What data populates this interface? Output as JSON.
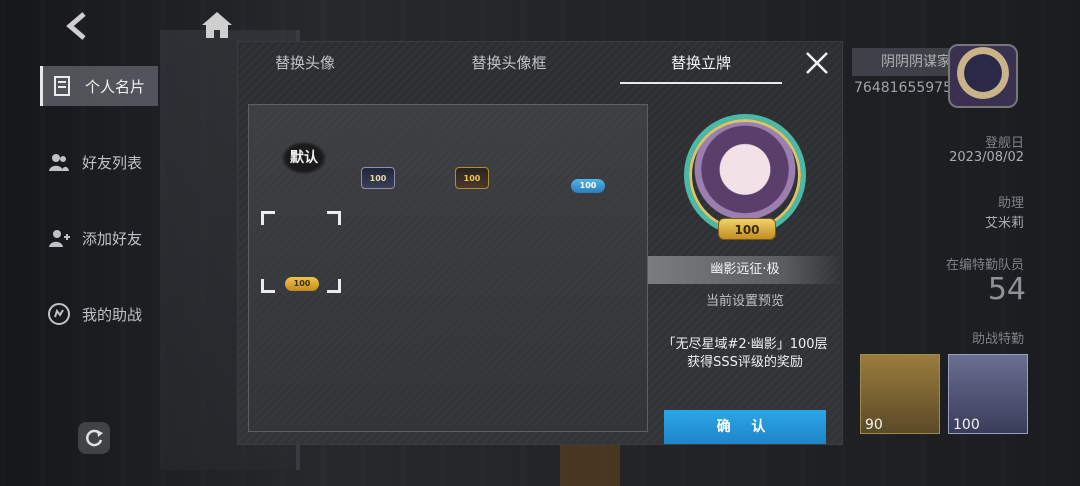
{
  "nav": {
    "back_icon": "back-arrow-icon",
    "home_icon": "home-icon"
  },
  "side_menu": {
    "items": [
      {
        "label": "个人名片",
        "icon": "id-card-icon",
        "active": true
      },
      {
        "label": "好友列表",
        "icon": "friends-icon",
        "active": false
      },
      {
        "label": "添加好友",
        "icon": "add-friend-icon",
        "active": false
      },
      {
        "label": "我的助战",
        "icon": "assist-icon",
        "active": false
      }
    ],
    "refresh_icon": "refresh-icon"
  },
  "profile": {
    "name": "阴阴阴谋家",
    "uid": "76481655975",
    "login_label": "登舰日",
    "login_date": "2023/08/02",
    "assistant_label": "助理",
    "assistant_name": "艾米莉",
    "team_label": "在编特勤队员",
    "team_count": "54",
    "assist_label": "助战特勤",
    "assist_cards": [
      {
        "level": "90"
      },
      {
        "level": "100"
      }
    ]
  },
  "modal": {
    "tabs": [
      {
        "label": "替换头像",
        "active": false
      },
      {
        "label": "替换头像框",
        "active": false
      },
      {
        "label": "替换立牌",
        "active": true
      }
    ],
    "close_icon": "close-icon",
    "grid": {
      "default_label": "默认",
      "plates": [
        {
          "text": "100",
          "style": "purple"
        },
        {
          "text": "100",
          "style": "gold-dark"
        },
        {
          "text": "100",
          "style": "blue"
        },
        {
          "text": "100",
          "style": "gold",
          "selected": true
        }
      ]
    },
    "preview": {
      "plate_text": "100",
      "name": "幽影远征·极",
      "caption": "当前设置预览",
      "desc_line1": "「无尽星域#2·幽影」100层",
      "desc_line2": "获得SSS评级的奖励",
      "confirm_label": "确 认"
    }
  },
  "colors": {
    "confirm_blue": "#1f93d8",
    "accent_gold": "#f1c64a"
  }
}
